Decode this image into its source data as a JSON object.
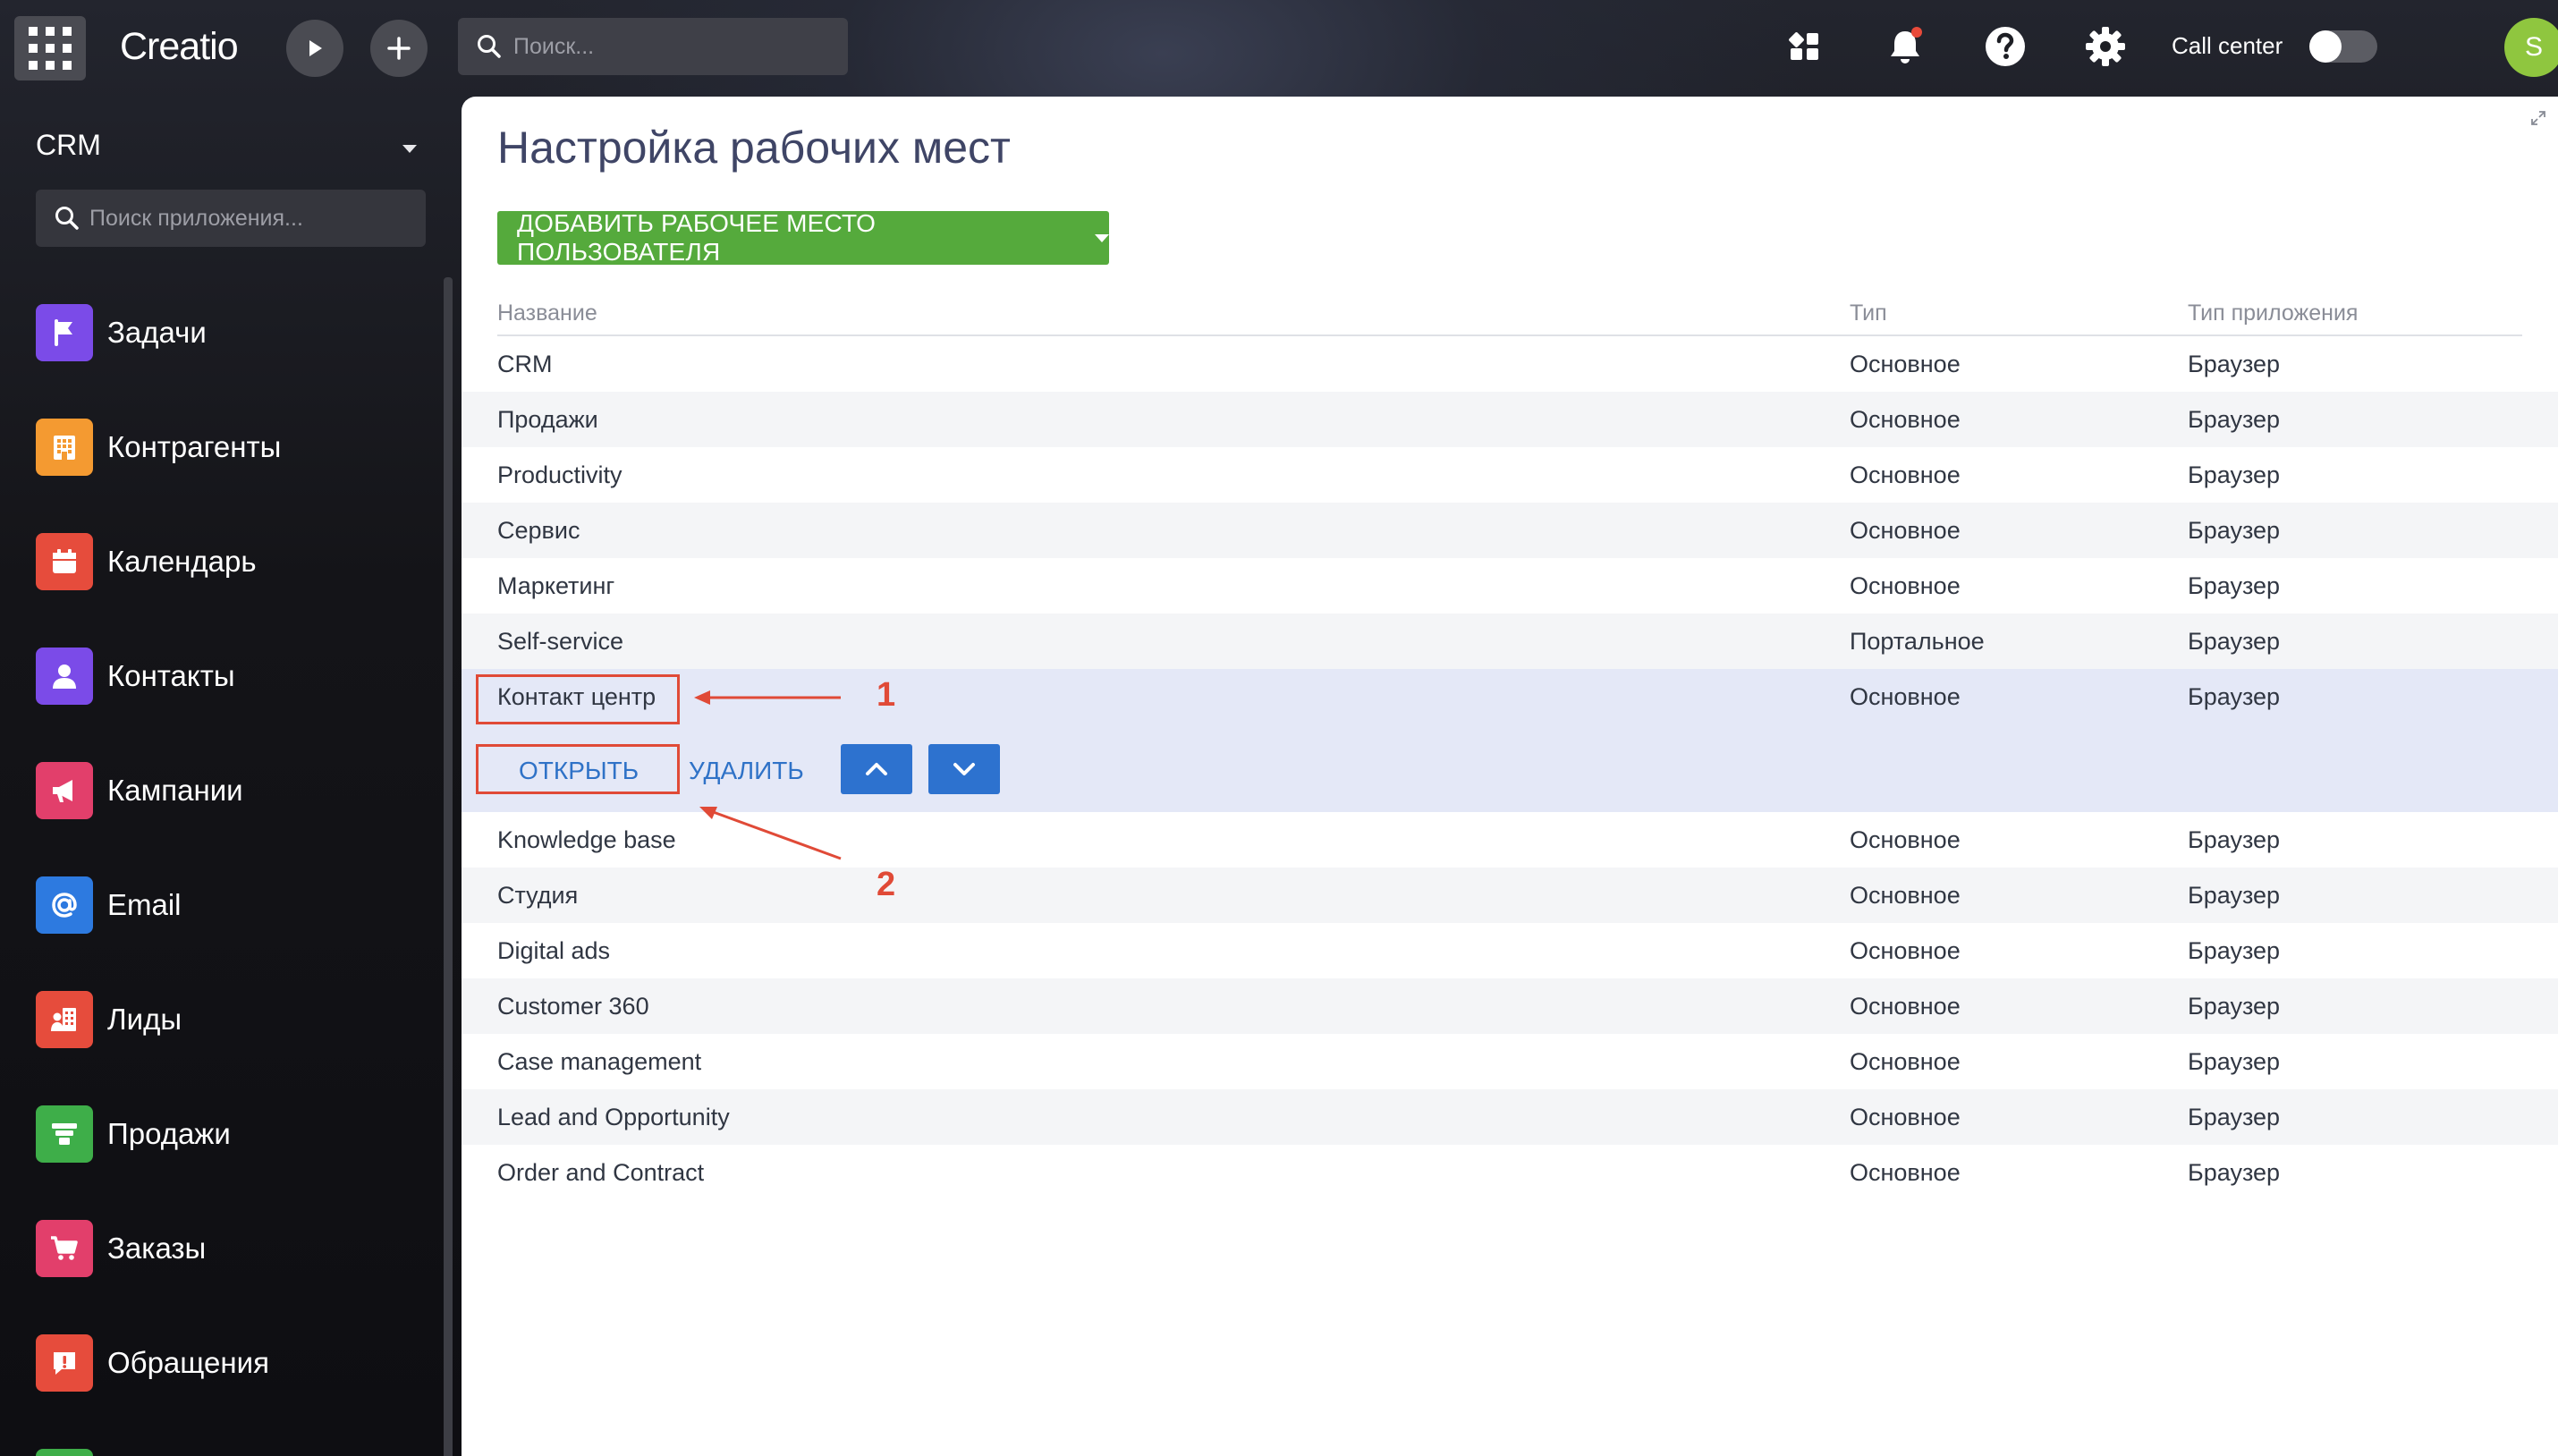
{
  "app": {
    "logo": "Creatio"
  },
  "topbar": {
    "search_placeholder": "Поиск...",
    "call_center_label": "Call center",
    "avatar_initial": "S"
  },
  "sidebar": {
    "workplace": "CRM",
    "search_placeholder": "Поиск приложения...",
    "items": [
      {
        "label": "Задачи",
        "color": "#7b4be8",
        "icon": "flag-icon"
      },
      {
        "label": "Контрагенты",
        "color": "#f49a31",
        "icon": "building-icon"
      },
      {
        "label": "Календарь",
        "color": "#e64c3c",
        "icon": "calendar-icon"
      },
      {
        "label": "Контакты",
        "color": "#7b4be8",
        "icon": "person-icon"
      },
      {
        "label": "Кампании",
        "color": "#e23f6b",
        "icon": "megaphone-icon"
      },
      {
        "label": "Email",
        "color": "#2d7ae0",
        "icon": "at-icon"
      },
      {
        "label": "Лиды",
        "color": "#e64c3c",
        "icon": "leads-icon"
      },
      {
        "label": "Продажи",
        "color": "#3eae49",
        "icon": "funnel-icon"
      },
      {
        "label": "Заказы",
        "color": "#e23f6b",
        "icon": "cart-icon"
      },
      {
        "label": "Обращения",
        "color": "#e64c3c",
        "icon": "alert-icon"
      }
    ]
  },
  "main": {
    "title": "Настройка рабочих мест",
    "add_button": "ДОБАВИТЬ РАБОЧЕЕ МЕСТО ПОЛЬЗОВАТЕЛЯ",
    "columns": [
      "Название",
      "Тип",
      "Тип приложения"
    ],
    "rows": [
      {
        "name": "CRM",
        "type": "Основное",
        "app_type": "Браузер"
      },
      {
        "name": "Продажи",
        "type": "Основное",
        "app_type": "Браузер"
      },
      {
        "name": "Productivity",
        "type": "Основное",
        "app_type": "Браузер"
      },
      {
        "name": "Сервис",
        "type": "Основное",
        "app_type": "Браузер"
      },
      {
        "name": "Маркетинг",
        "type": "Основное",
        "app_type": "Браузер"
      },
      {
        "name": "Self-service",
        "type": "Портальное",
        "app_type": "Браузер"
      },
      {
        "name": "Контакт центр",
        "type": "Основное",
        "app_type": "Браузер"
      },
      {
        "name": "Knowledge base",
        "type": "Основное",
        "app_type": "Браузер"
      },
      {
        "name": "Студия",
        "type": "Основное",
        "app_type": "Браузер"
      },
      {
        "name": "Digital ads",
        "type": "Основное",
        "app_type": "Браузер"
      },
      {
        "name": "Customer 360",
        "type": "Основное",
        "app_type": "Браузер"
      },
      {
        "name": "Case management",
        "type": "Основное",
        "app_type": "Браузер"
      },
      {
        "name": "Lead and Opportunity",
        "type": "Основное",
        "app_type": "Браузер"
      },
      {
        "name": "Order and Contract",
        "type": "Основное",
        "app_type": "Браузер"
      }
    ],
    "row_actions": {
      "open": "ОТКРЫТЬ",
      "delete": "УДАЛИТЬ"
    }
  },
  "annotations": {
    "one": "1",
    "two": "2"
  }
}
